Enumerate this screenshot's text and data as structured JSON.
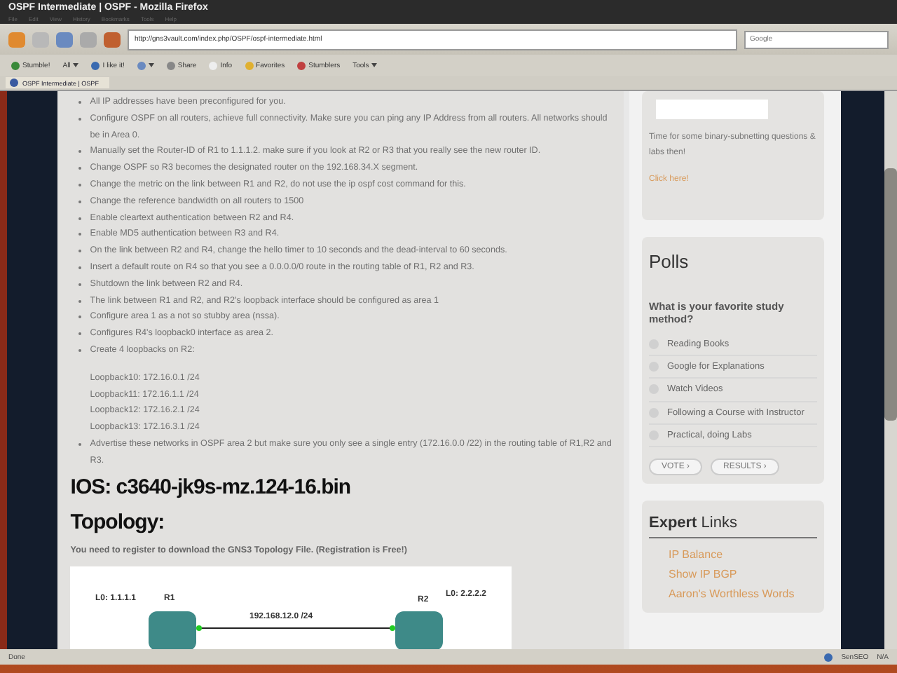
{
  "window": {
    "title": "OSPF Intermediate | OSPF - Mozilla Firefox"
  },
  "menu": [
    "File",
    "Edit",
    "View",
    "History",
    "Bookmarks",
    "Tools",
    "Help"
  ],
  "address": {
    "value": "http://gns3vault.com/index.php/OSPF/ospf-intermediate.html"
  },
  "search": {
    "placeholder": "Google"
  },
  "addon_bar": [
    {
      "label": "Stumble!",
      "kind": "stumble"
    },
    {
      "label": "All",
      "kind": "menu"
    },
    {
      "label": "I like it!",
      "kind": "like"
    },
    {
      "kind": "tag"
    },
    {
      "label": "Share",
      "kind": "share"
    },
    {
      "label": "Info",
      "kind": "info"
    },
    {
      "label": "Favorites",
      "kind": "star"
    },
    {
      "label": "Stumblers",
      "kind": "people"
    },
    {
      "label": "Tools",
      "kind": "menu"
    }
  ],
  "tab": {
    "label": "OSPF Intermediate | OSPF"
  },
  "article": {
    "tasks": [
      "All IP addresses have been preconfigured for you.",
      "Configure OSPF on all routers, achieve full connectivity. Make sure you can ping any IP Address from all routers. All networks should be in Area 0.",
      "Manually set the Router-ID of R1 to 1.1.1.2. make sure if you look at R2 or R3 that you really see the new router ID.",
      "Change OSPF so R3 becomes the designated router on the 192.168.34.X segment.",
      "Change the metric on the link between R1 and R2, do not use the ip ospf cost command for this.",
      "Change the reference bandwidth on all routers to 1500",
      "Enable cleartext authentication between R2 and R4.",
      "Enable MD5 authentication between R3 and R4.",
      "On the link between R2 and R4, change the hello timer to 10 seconds and the dead-interval to 60 seconds.",
      "Insert a default route on R4 so that you see a 0.0.0.0/0 route in the routing table of R1, R2 and R3.",
      "Shutdown the link between R2 and R4.",
      "The link between R1 and R2, and R2's loopback interface should be configured as area 1",
      "Configure area 1 as a not so stubby area (nssa).",
      "Configures R4's loopback0 interface as area 2.",
      "Create 4 loopbacks on R2:"
    ],
    "loopbacks": [
      "Loopback10: 172.16.0.1 /24",
      "Loopback11: 172.16.1.1 /24",
      "Loopback12: 172.16.2.1 /24",
      "Loopback13: 172.16.3.1 /24"
    ],
    "final_task": "Advertise these networks in OSPF area 2 but make sure you only see a single entry (172.16.0.0 /22) in the routing table of R1,R2 and R3.",
    "ios_heading": "IOS: c3640-jk9s-mz.124-16.bin",
    "topology_heading": "Topology:",
    "register_note": "You need to register to download the GNS3 Topology File. (Registration is Free!)",
    "diagram": {
      "r1_loopback": "L0: 1.1.1.1",
      "r1": "R1",
      "link": "192.168.12.0 /24",
      "r2": "R2",
      "r2_loopback": "L0: 2.2.2.2"
    }
  },
  "sidebar": {
    "promo_text": "Time for some binary-subnetting questions & labs then!",
    "promo_link": "Click here!",
    "polls": {
      "title": "Polls",
      "question": "What is your favorite study method?",
      "options": [
        {
          "label": "Reading Books",
          "selected": false
        },
        {
          "label": "Google for Explanations",
          "selected": false
        },
        {
          "label": "Watch Videos",
          "selected": false
        },
        {
          "label": "Following a Course with Instructor",
          "selected": false
        },
        {
          "label": "Practical, doing Labs",
          "selected": false
        }
      ],
      "buttons": [
        "VOTE ›",
        "RESULTS ›"
      ]
    },
    "links_title": "**Expert** Links",
    "links": [
      "IP Balance",
      "Show IP BGP",
      "Aaron's Worthless Words"
    ]
  },
  "status_bar": {
    "text": "Done",
    "seo": "SenSEO",
    "rank": "N/A"
  }
}
